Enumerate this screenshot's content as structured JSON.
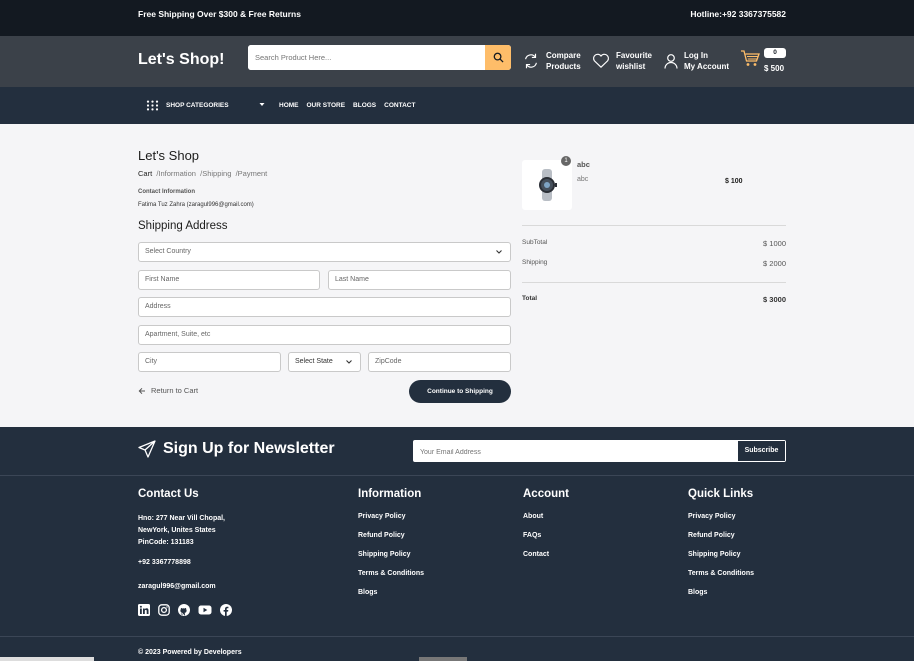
{
  "topbar": {
    "left": "Free Shipping Over $300 & Free Returns",
    "right": "Hotline:+92 3367375582"
  },
  "header": {
    "logo": "Let's Shop!",
    "search_placeholder": "Search Product Here...",
    "compare": [
      "Compare",
      "Products"
    ],
    "wishlist": [
      "Favourite",
      "wishlist"
    ],
    "account": [
      "Log In",
      "My Account"
    ],
    "cart_count": "0",
    "cart_total": "$ 500"
  },
  "nav": {
    "categories": "SHOP CATEGORIES",
    "links": [
      "HOME",
      "OUR STORE",
      "BLOGS",
      "CONTACT"
    ]
  },
  "checkout": {
    "title": "Let's Shop",
    "breadcrumb": [
      "Cart",
      "/Information",
      "/Shipping",
      "/Payment"
    ],
    "contact_label": "Contact Information",
    "contact_value": "Fatima Tuz Zahra (zaragul996@gmail.com)",
    "shipping_title": "Shipping Address",
    "country": "Select Country",
    "first_name": "First Name",
    "last_name": "Last Name",
    "address": "Address",
    "apartment": "Apartment, Suite, etc",
    "city": "City",
    "state": "Select State",
    "zip": "ZipCode",
    "return": "Return to Cart",
    "continue": "Continue to Shipping"
  },
  "summary": {
    "item": {
      "qty": "1",
      "name": "abc",
      "desc": "abc",
      "price": "$ 100"
    },
    "subtotal_label": "SubTotal",
    "subtotal": "$ 1000",
    "shipping_label": "Shipping",
    "shipping": "$ 2000",
    "total_label": "Total",
    "total": "$ 3000"
  },
  "newsletter": {
    "title": "Sign Up for Newsletter",
    "placeholder": "Your Email Address",
    "button": "Subscribe"
  },
  "footer": {
    "contact": {
      "title": "Contact Us",
      "address": [
        "Hno: 277 Near Vill Chopal,",
        "NewYork, Unites States",
        "PinCode: 131183"
      ],
      "phone": "+92 3367778898",
      "email": "zaragul996@gmail.com"
    },
    "information": {
      "title": "Information",
      "links": [
        "Privacy Policy",
        "Refund Policy",
        "Shipping Policy",
        "Terms & Conditions",
        "Blogs"
      ]
    },
    "account": {
      "title": "Account",
      "links": [
        "About",
        "FAQs",
        "Contact"
      ]
    },
    "quick": {
      "title": "Quick Links",
      "links": [
        "Privacy Policy",
        "Refund Policy",
        "Shipping Policy",
        "Terms & Conditions",
        "Blogs"
      ]
    },
    "copyright": "© 2023 Powered by Developers"
  },
  "colors": {
    "dark": "#131921",
    "header": "#3b4149",
    "nav": "#232f3e",
    "accent": "#febd69"
  }
}
